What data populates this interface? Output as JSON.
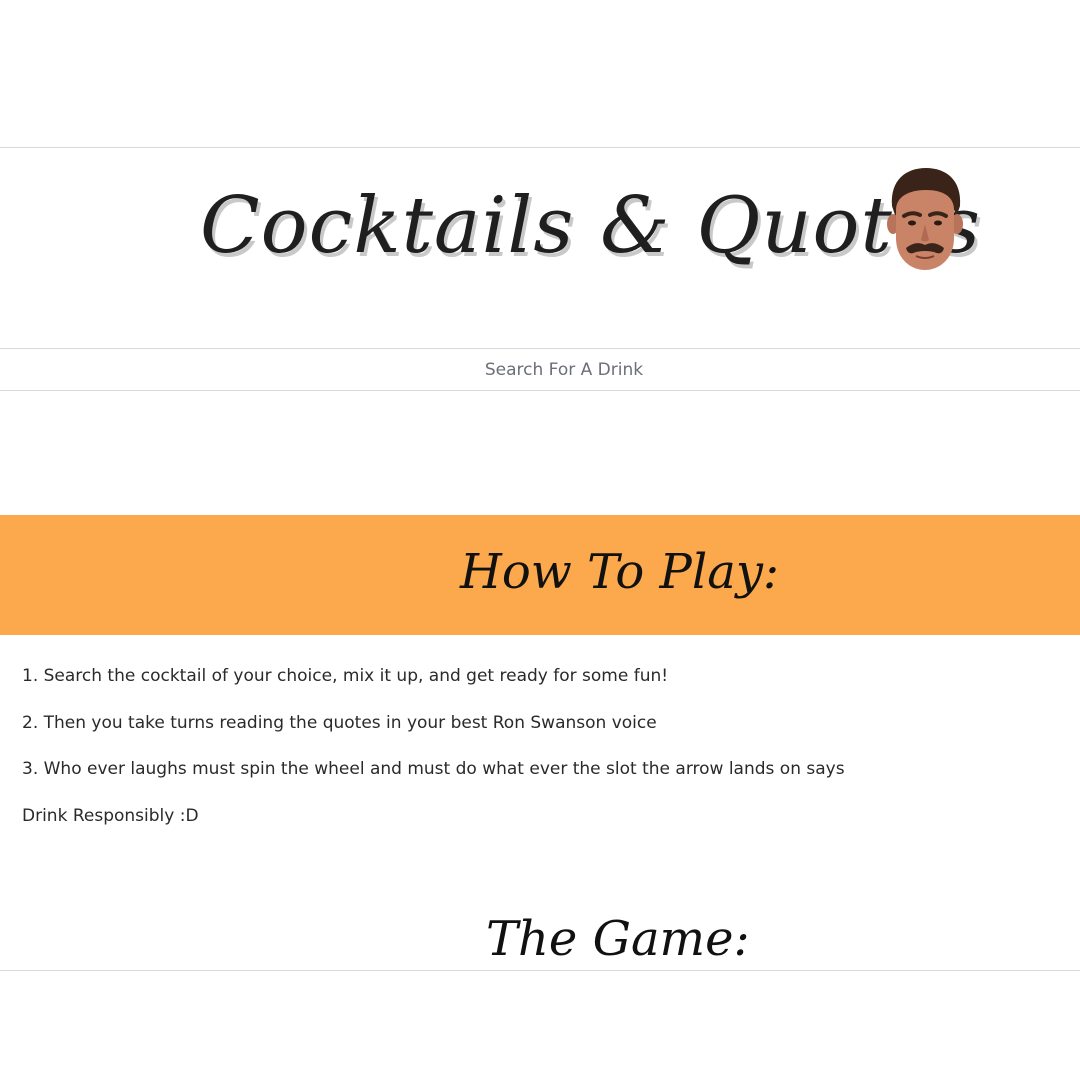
{
  "header": {
    "title": "Cocktails & Quotes",
    "avatar_icon": "ron-swanson-face-icon"
  },
  "search": {
    "placeholder": "Search For A Drink",
    "value": ""
  },
  "how_to_play": {
    "title": "How To Play:",
    "banner_color": "#fba94c",
    "rules": [
      "1. Search the cocktail of your choice, mix it up, and get ready for some fun!",
      "2. Then you take turns reading the quotes in your best Ron Swanson voice",
      "3. Who ever laughs must spin the wheel and must do what ever the slot the arrow lands on says",
      "Drink Responsibly :D"
    ]
  },
  "game": {
    "title": "The Game:"
  }
}
